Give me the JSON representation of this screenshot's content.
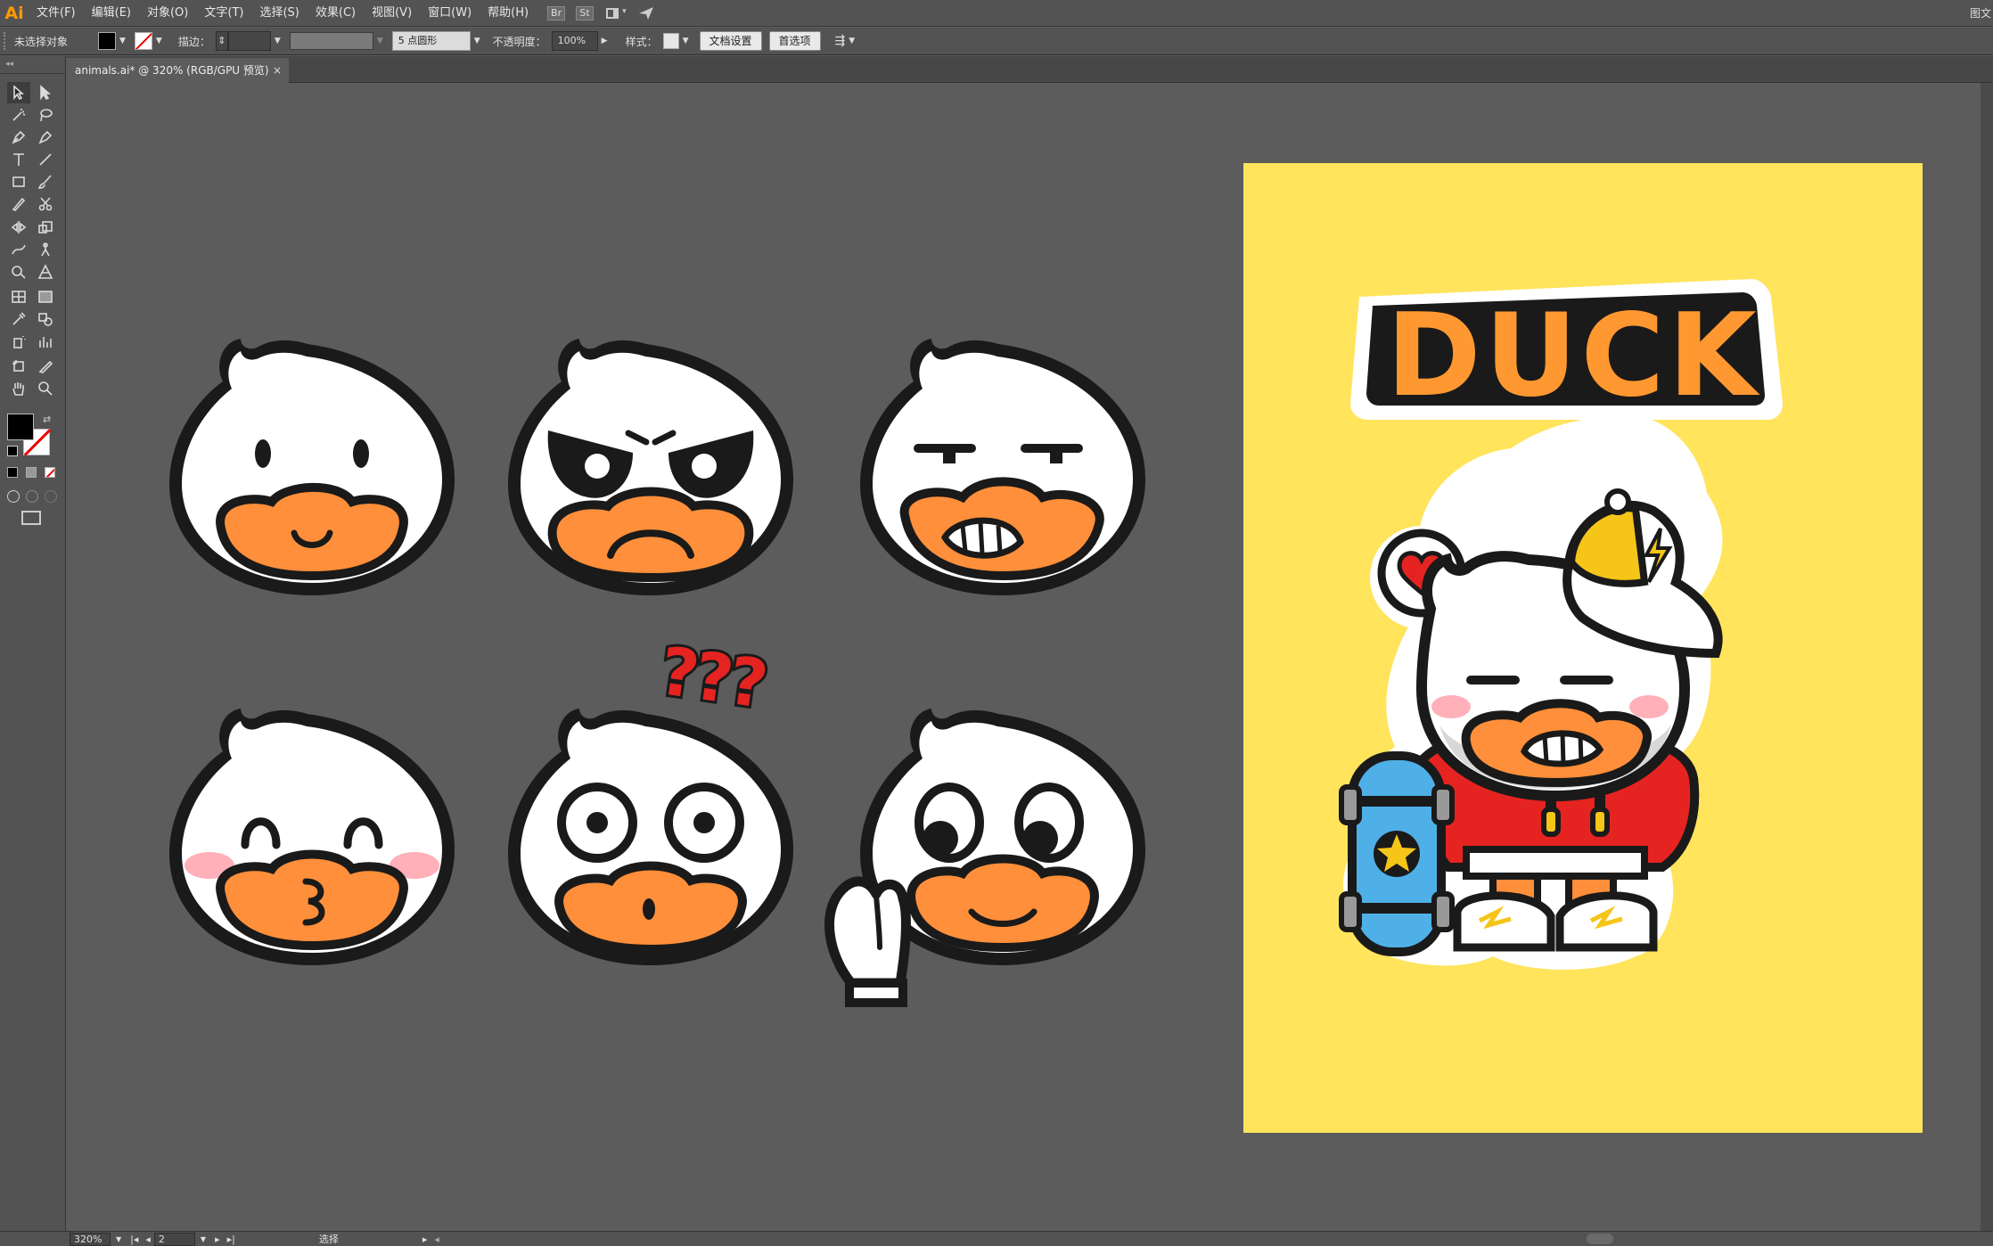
{
  "app": {
    "logo": "Ai",
    "right_edge_label": "图文"
  },
  "menu": [
    "文件(F)",
    "编辑(E)",
    "对象(O)",
    "文字(T)",
    "选择(S)",
    "效果(C)",
    "视图(V)",
    "窗口(W)",
    "帮助(H)"
  ],
  "menubar_icons": {
    "bridge": "Br",
    "stock": "St"
  },
  "controlbar": {
    "selection_status": "未选择对象",
    "stroke_label": "描边：",
    "brush_value": "5 点圆形",
    "opacity_label": "不透明度：",
    "opacity_value": "100%",
    "style_label": "样式：",
    "doc_setup_button": "文档设置",
    "preferences_button": "首选项"
  },
  "document_tab": {
    "title": "animals.ai* @ 320% (RGB/GPU 预览)",
    "close": "×"
  },
  "statusbar": {
    "zoom": "320%",
    "artboard_number": "2",
    "tool_status": "选择"
  },
  "artwork": {
    "artboard_color": "#ffe45c",
    "poster_title": "DUCK",
    "question_marks": "???",
    "faces": [
      "smile",
      "angry",
      "smirk",
      "blush-kiss",
      "surprised",
      "waving"
    ],
    "colors": {
      "orange": "#ff8f3a",
      "outline": "#1a1a1a",
      "blush": "#ffb0b8",
      "red": "#e52421",
      "title": "#ff9830"
    }
  }
}
